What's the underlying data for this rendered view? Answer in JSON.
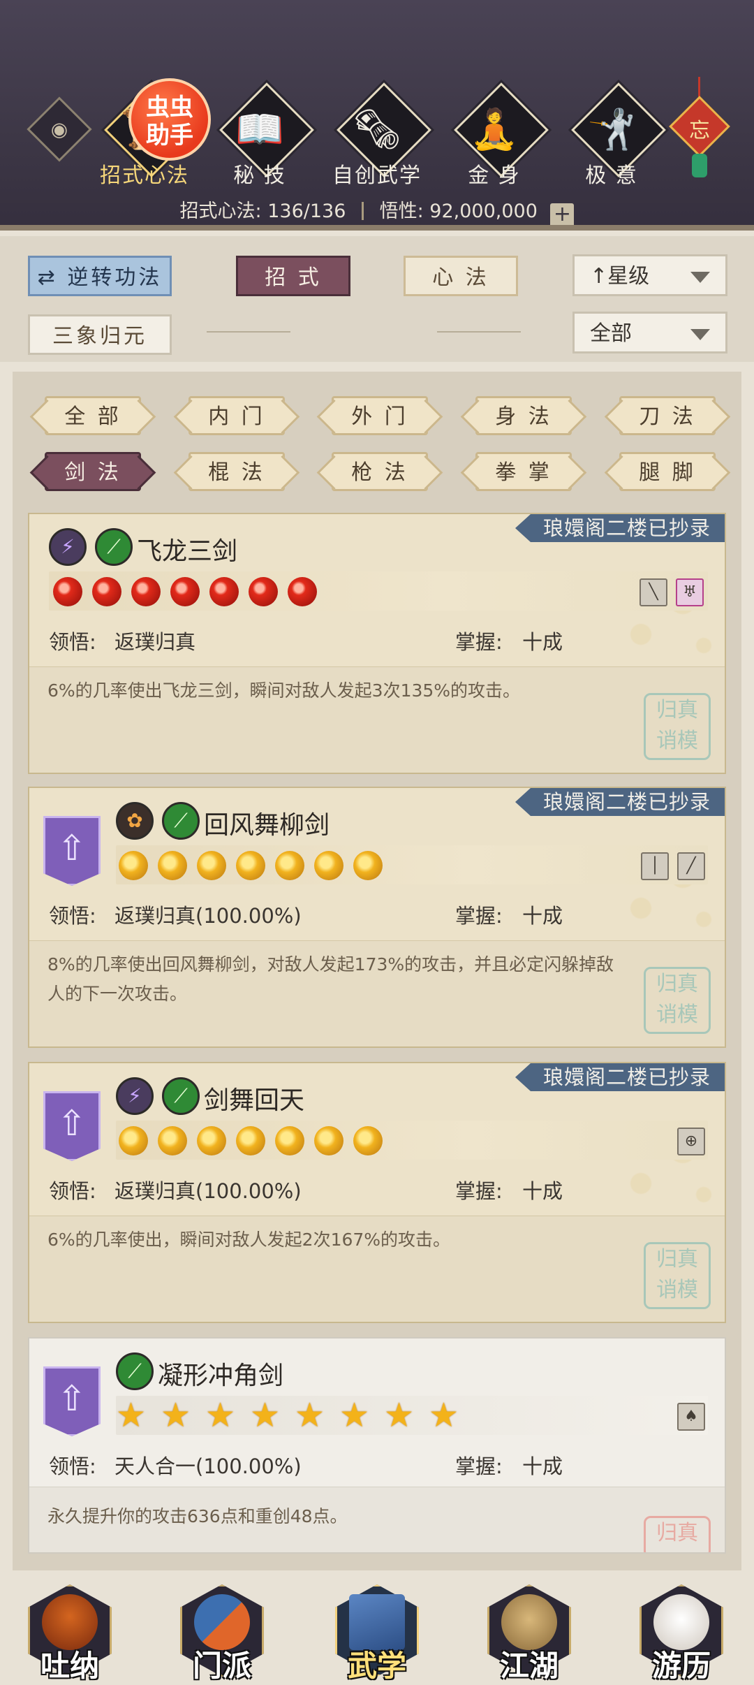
{
  "header": {
    "badge": "虫虫\n助手",
    "categories": [
      {
        "label": "招式心法",
        "icon": "sword-manual-icon",
        "active": true
      },
      {
        "label": "秘 技",
        "icon": "book-icon"
      },
      {
        "label": "自创武学",
        "icon": "scroll-icon"
      },
      {
        "label": "金 身",
        "icon": "meditation-icon"
      },
      {
        "label": "极 意",
        "icon": "martial-stance-icon"
      }
    ],
    "knot_char": "忘",
    "stats": {
      "skills_label": "招式心法:",
      "skills_value": "136/136",
      "insight_label": "悟性:",
      "insight_value": "92,000,000",
      "plus": "+"
    }
  },
  "filters": {
    "reverse": "逆转功法",
    "reverse_icon": "⇄",
    "tab_moves": "招 式",
    "tab_mind": "心 法",
    "sort": "星级",
    "sort_icon": "↑",
    "three": "三象归元",
    "scope": "全部"
  },
  "types": {
    "row1": [
      "全 部",
      "内 门",
      "外 门",
      "身 法",
      "刀 法"
    ],
    "row2": [
      "剑 法",
      "棍 法",
      "枪 法",
      "拳 掌",
      "腿 脚"
    ],
    "selected": "剑 法"
  },
  "cards": [
    {
      "name": "飞龙三剑",
      "ribbon": "琅嬛阁二楼已抄录",
      "orb_type": "red",
      "orb_count": 7,
      "comprehension_label": "领悟:",
      "comprehension": "返璞归真",
      "mastery_label": "掌握:",
      "mastery": "十成",
      "desc": "6%的几率使出飞龙三剑，瞬间对敌人发起3次135%的攻击。"
    },
    {
      "name": "回风舞柳剑",
      "ribbon": "琅嬛阁二楼已抄录",
      "orb_type": "moon",
      "orb_count": 7,
      "comprehension_label": "领悟:",
      "comprehension": "返璞归真(100.00%)",
      "mastery_label": "掌握:",
      "mastery": "十成",
      "desc": "8%的几率使出回风舞柳剑，对敌人发起173%的攻击，并且必定闪躲掉敌人的下一次攻击。"
    },
    {
      "name": "剑舞回天",
      "ribbon": "琅嬛阁二楼已抄录",
      "orb_type": "moon",
      "orb_count": 7,
      "comprehension_label": "领悟:",
      "comprehension": "返璞归真(100.00%)",
      "mastery_label": "掌握:",
      "mastery": "十成",
      "desc": "6%的几率使出，瞬间对敌人发起2次167%的攻击。"
    },
    {
      "name": "凝形冲角剑",
      "orb_type": "star",
      "orb_count": 8,
      "comprehension_label": "领悟:",
      "comprehension": "天人合一(100.00%)",
      "mastery_label": "掌握:",
      "mastery": "十成",
      "desc": "永久提升你的攻击636点和重创48点。"
    }
  ],
  "seal_text": "归真\n诮模",
  "bottom_nav": [
    {
      "label": "吐纳",
      "icon": "monk-icon"
    },
    {
      "label": "门派",
      "icon": "sect-icon"
    },
    {
      "label": "武学",
      "icon": "manual-icon",
      "active": true
    },
    {
      "label": "江湖",
      "icon": "straw-hat-icon"
    },
    {
      "label": "游历",
      "icon": "horse-icon"
    }
  ]
}
